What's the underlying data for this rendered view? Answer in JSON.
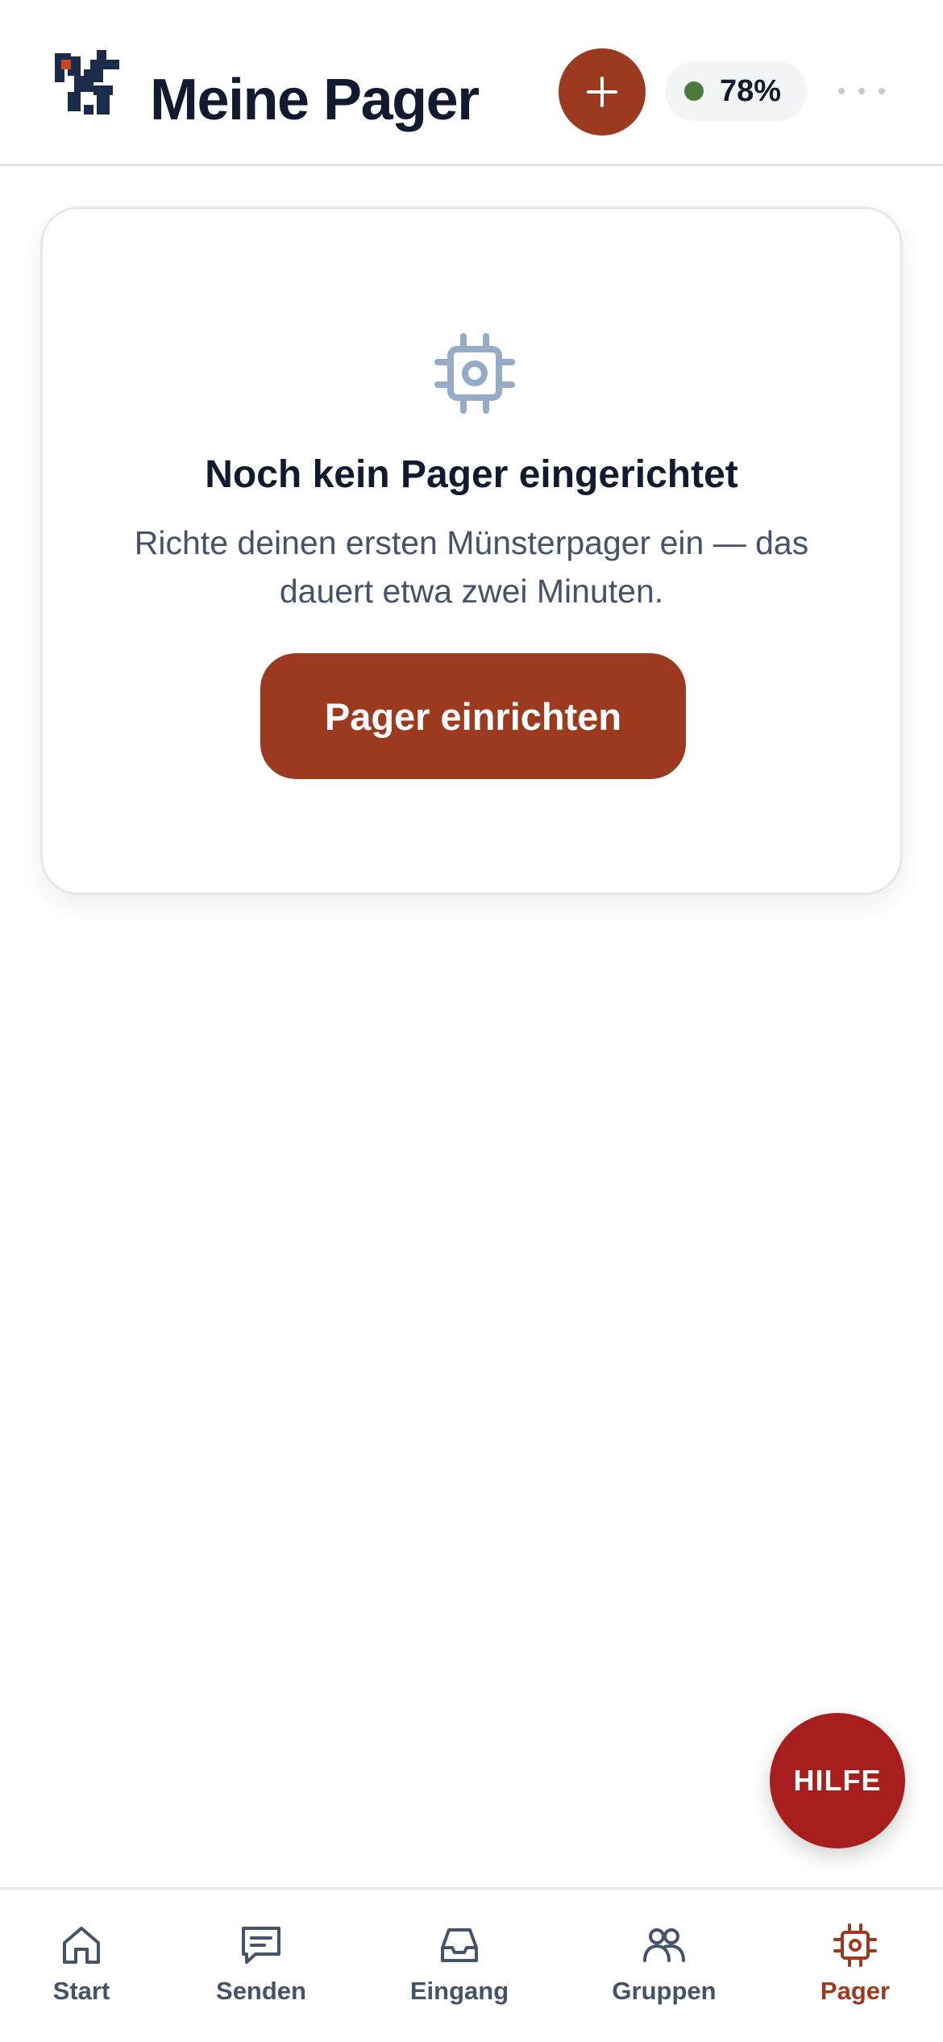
{
  "header": {
    "title": "Meine Pager",
    "add_icon": "plus-icon",
    "battery": {
      "value": "78%",
      "status_color": "#4a7a3d"
    },
    "more_icon": "more-horizontal-icon"
  },
  "empty_state": {
    "icon": "chip-icon",
    "title": "Noch kein Pager eingerichtet",
    "description": "Richte deinen ersten Münsterpager ein — das dauert etwa zwei Minuten.",
    "button_label": "Pager einrichten"
  },
  "help": {
    "label": "HILFE"
  },
  "nav": {
    "items": [
      {
        "label": "Start",
        "icon": "home-icon",
        "active": false
      },
      {
        "label": "Senden",
        "icon": "message-icon",
        "active": false
      },
      {
        "label": "Eingang",
        "icon": "inbox-icon",
        "active": false
      },
      {
        "label": "Gruppen",
        "icon": "group-icon",
        "active": false
      },
      {
        "label": "Pager",
        "icon": "chip-icon",
        "active": true
      }
    ]
  },
  "colors": {
    "accent": "#9c3a1f",
    "help": "#a81e1e",
    "text_dark": "#111a2e",
    "text_muted": "#45536a",
    "icon_soft": "#94acc7"
  }
}
